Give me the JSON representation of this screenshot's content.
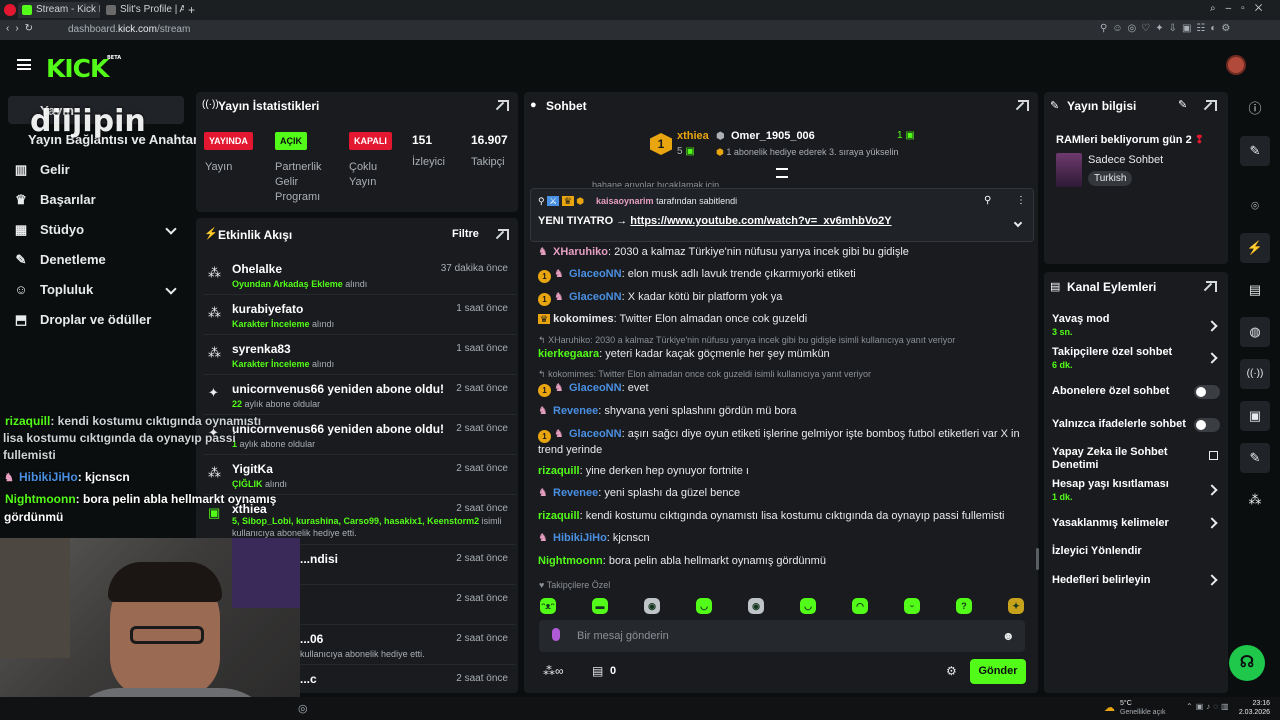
{
  "browser": {
    "tabs": [
      {
        "title": "Stream - Kick Dashboard",
        "fav_color": "#53fc18"
      },
      {
        "title": "Slit's Profile | Akasha Syst...",
        "fav_color": "#6a6a6a"
      }
    ],
    "url_domain": "dashboard.",
    "url_host": "kick.com",
    "url_path": "/stream"
  },
  "header": {
    "logo": "KICK",
    "beta": "BETA"
  },
  "sidebar": {
    "items": [
      {
        "label": "Yayın Bağlantısı ve Anahtarı",
        "icon": "link-icon"
      },
      {
        "label": "Gelir",
        "icon": "chart-icon"
      },
      {
        "label": "Başarılar",
        "icon": "trophy-icon"
      },
      {
        "label": "Stüdyo",
        "icon": "grid-icon"
      },
      {
        "label": "Denetleme",
        "icon": "wrench-icon"
      },
      {
        "label": "Topluluk",
        "icon": "people-icon"
      },
      {
        "label": "Droplar ve ödüller",
        "icon": "gift-icon"
      }
    ],
    "top_stub": "Yayın"
  },
  "stats": {
    "title": "Yayın İstatistikleri",
    "badges": [
      {
        "label": "YAYINDA",
        "color": "#e3172f",
        "text": "#ffffff"
      },
      {
        "label": "AÇIK",
        "color": "#53fc18",
        "text": "#0b0e0f"
      },
      {
        "label": "KAPALI",
        "color": "#e3172f",
        "text": "#ffffff"
      }
    ],
    "labels": [
      "Yayın",
      "Partnerlik Gelir Programı",
      "Çoklu Yayın"
    ],
    "viewers_value": "151",
    "viewers_label": "İzleyici",
    "followers_value": "16.907",
    "followers_label": "Takipçi"
  },
  "activity": {
    "title": "Etkinlik Akışı",
    "filter": "Filtre",
    "rows": [
      {
        "name": "Ohelalke",
        "time": "37 dakika önce",
        "sub_green": "Oyundan Arkadaş Ekleme",
        "sub_rest": " alındı"
      },
      {
        "name": "kurabiyefato",
        "time": "1 saat önce",
        "sub_green": "Karakter İnceleme",
        "sub_rest": " alındı"
      },
      {
        "name": "syrenka83",
        "time": "1 saat önce",
        "sub_green": "Karakter İnceleme",
        "sub_rest": " alındı"
      },
      {
        "name": "unicornvenus66 yeniden abone oldu!",
        "time": "2 saat önce",
        "sub_green": "22",
        "sub_rest": " aylık abone oldular"
      },
      {
        "name": "unicornvenus66 yeniden abone oldu!",
        "time": "2 saat önce",
        "sub_green": "1",
        "sub_rest": " aylık abone oldular"
      },
      {
        "name": "YigitKa",
        "time": "2 saat önce",
        "sub_green": "ÇIĞLIK",
        "sub_rest": " alındı"
      },
      {
        "name": "xthiea",
        "time": "2 saat önce",
        "sub_green": "5, Sibop_Lobi, kurashina, Carso99, hasakix1, Keenstorm2",
        "sub_rest": " isimli"
      },
      {
        "name": "...ndisi",
        "time": "2 saat önce",
        "sub_green": "",
        "sub_rest": ""
      },
      {
        "name": "",
        "time": "2 saat önce",
        "sub_green": "",
        "sub_rest": ""
      },
      {
        "name": "...06",
        "time": "2 saat önce",
        "sub_green": "",
        "sub_rest": "kullanıcıya abonelik hediye etti."
      },
      {
        "name": "...c",
        "time": "2 saat önce",
        "sub_green": "",
        "sub_rest": ""
      }
    ],
    "row7_line2": "kullanıcıya abonelik hediye etti."
  },
  "chat": {
    "title": "Sohbet",
    "top_gifter": {
      "name": "xthiea",
      "count": "5",
      "rank": "1"
    },
    "second": {
      "name": "Omer_1905_006",
      "count": "1",
      "note": "1 abonelik hediye ederek 3. sıraya yükselin"
    },
    "cut_line": "bahane arıyolar bıçakIamak için",
    "pinned": {
      "by": "kaisaoynarim",
      "by_suffix": "tarafından sabitlendi",
      "text": "YENI TIYATRO → ",
      "link": "https://www.youtube.com/watch?v=_xv6mhbVo2Y"
    },
    "messages": [
      {
        "user": "XHaruhiko",
        "color": "#e79fc1",
        "text": "2030 a kalmaz Türkiye'nin nüfusu yarıya incek gibi bu gidişle"
      },
      {
        "user": "GlaceoNN",
        "color": "#4a90e2",
        "text": "elon musk adlı lavuk trende çıkarmıyorki etiketi"
      },
      {
        "user": "GlaceoNN",
        "color": "#4a90e2",
        "text": "X kadar kötü bir platform yok ya"
      },
      {
        "user": "kokomimes",
        "color": "#e8eaec",
        "text": "Twitter Elon almadan once cok guzeldi"
      },
      {
        "user": "kierkegaara",
        "color": "#53fc18",
        "text": "yeteri kadar kaçak göçmenle her şey mümkün"
      },
      {
        "user": "GlaceoNN",
        "color": "#4a90e2",
        "text": "evet"
      },
      {
        "user": "Revenee",
        "color": "#4a90e2",
        "text": "shyvana yeni splashını gördün mü bora"
      },
      {
        "user": "GlaceoNN",
        "color": "#4a90e2",
        "text": "aşırı sağcı diye oyun etiketi işlerine gelmiyor işte bomboş futbol etiketleri var X in trend yerinde"
      },
      {
        "user": "rizaquill",
        "color": "#53fc18",
        "text": "yine derken hep oynuyor fortnite ı"
      },
      {
        "user": "Revenee",
        "color": "#4a90e2",
        "text": "yeni splashı da güzel bence"
      },
      {
        "user": "rizaquill",
        "color": "#53fc18",
        "text": "kendi kostumu cıktıgında oynamıstı lisa kostumu cıktıgında da oynayıp passi fullemisti"
      },
      {
        "user": "HibikiJiHo",
        "color": "#4a90e2",
        "text": "kjcnscn"
      },
      {
        "user": "Nightmoonn",
        "color": "#53fc18",
        "text": "bora pelin abla hellmarkt oynamış gördünmü"
      }
    ],
    "reply1": "XHaruhiko: 2030 a kalmaz Türkiye'nin nüfusu yarıya incek gibi bu gidişle isimli kullanıcıya yanıt veriyor",
    "reply2": "kokomimes: Twitter Elon almadan once cok guzeldi isimli kullanıcıya yanıt veriyor",
    "followers_only": "Takipçilere Özel",
    "input_placeholder": "Bir mesaj gönderin",
    "points": "0",
    "send": "Gönder"
  },
  "stream_info": {
    "title": "Yayın bilgisi",
    "stream_title": "RAMleri bekliyorum gün 2",
    "category": "Sadece Sohbet",
    "tag": "Turkish"
  },
  "channel_actions": {
    "title": "Kanal Eylemleri",
    "rows": [
      {
        "label": "Yavaş mod",
        "sub": "3 sn."
      },
      {
        "label": "Takipçilere özel sohbet",
        "sub": "6 dk."
      },
      {
        "label": "Abonelere özel sohbet",
        "sub": ""
      },
      {
        "label": "Yalnızca ifadelerle sohbet",
        "sub": ""
      },
      {
        "label": "Yapay Zeka ile Sohbet Denetimi",
        "sub": ""
      },
      {
        "label": "Hesap yaşı kısıtlaması",
        "sub": "1 dk."
      },
      {
        "label": "Yasaklanmış kelimeler",
        "sub": ""
      },
      {
        "label": "İzleyici Yönlendir",
        "sub": ""
      },
      {
        "label": "Hedefleri belirleyin",
        "sub": ""
      }
    ]
  },
  "overlay": {
    "logo_text": "diijipin",
    "chat": [
      {
        "user": "rizaquill",
        "color": "#53fc18",
        "text": ": kendi kostumu cıktıgında oynamıstı"
      },
      {
        "user": "",
        "color": "#ffffff",
        "text": "lisa kostumu cıktıgında da oynayıp passi"
      },
      {
        "user": "",
        "color": "#ffffff",
        "text": "fullemisti"
      },
      {
        "user": "HibikiJiHo",
        "color": "#4a90e2",
        "text": ": kjcnscn"
      },
      {
        "user": "Nightmoonn",
        "color": "#53fc18",
        "text": ": bora pelin abla hellmarkt oynamış"
      },
      {
        "user": "",
        "color": "#ffffff",
        "text": "gördünmü"
      }
    ]
  },
  "taskbar": {
    "temp": "5°C",
    "weather": "Genellikle açık",
    "time": "23:16",
    "date": "2.03.2026"
  },
  "colors": {
    "accent": "#53fc18",
    "panel": "#191b1f",
    "bg": "#0b0e0f"
  }
}
